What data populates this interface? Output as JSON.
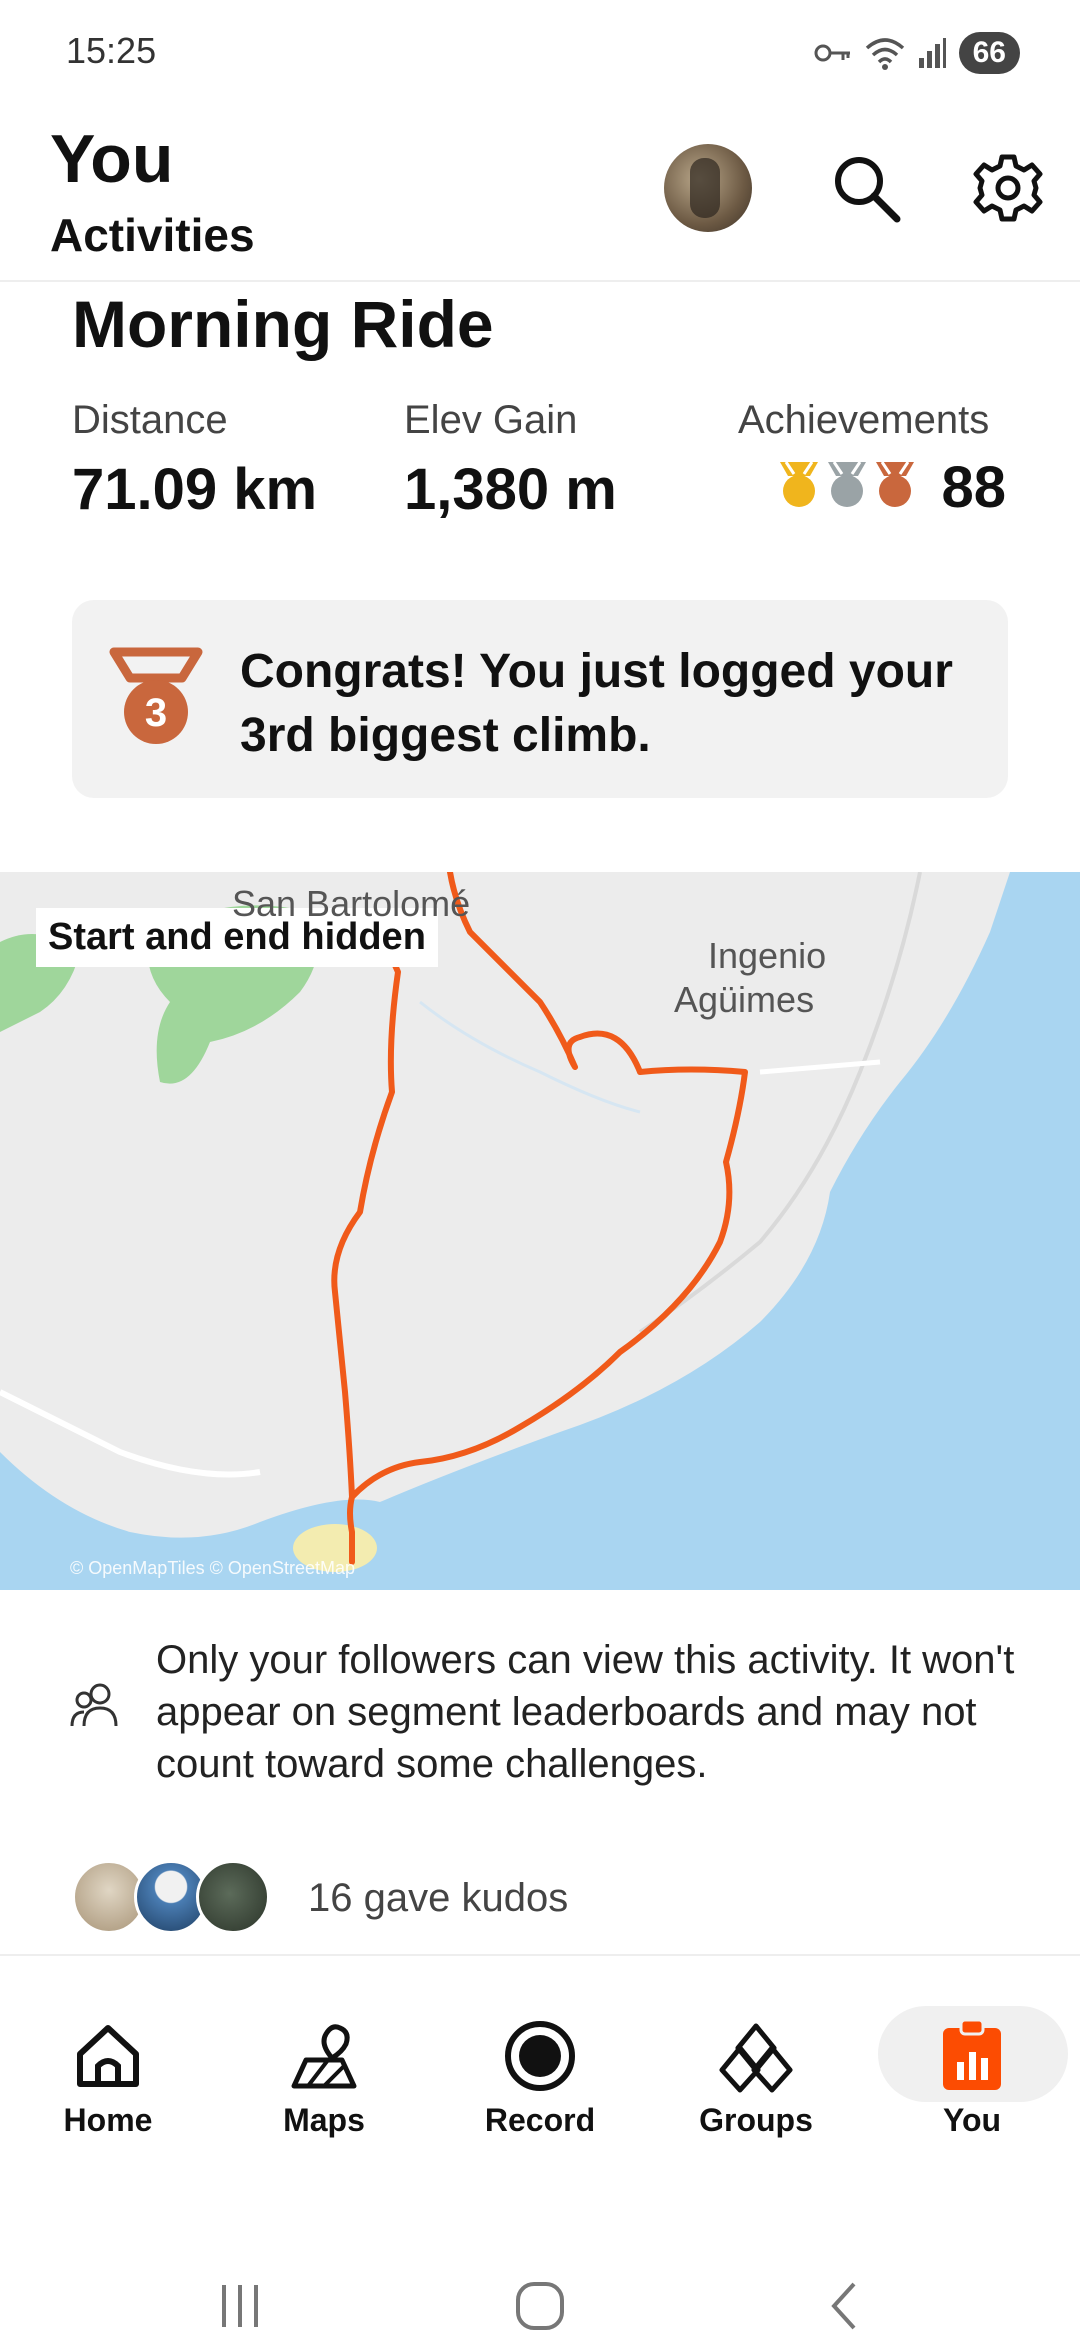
{
  "status_bar": {
    "time": "15:25",
    "battery": "66"
  },
  "header": {
    "title": "You",
    "subtitle": "Activities"
  },
  "activity": {
    "title": "Morning Ride",
    "stats": [
      {
        "label": "Distance",
        "value": "71.09 km"
      },
      {
        "label": "Elev Gain",
        "value": "1,380 m"
      },
      {
        "label": "Achievements",
        "value": "88"
      }
    ],
    "medal_colors": [
      "#f0b51d",
      "#9aa3a6",
      "#c9673d"
    ],
    "congrats": {
      "text": "Congrats! You just logged your 3rd biggest climb.",
      "medal_number": "3",
      "medal_color": "#c9673d"
    }
  },
  "map": {
    "badge": "Start and end hidden",
    "places": [
      "San Bartolomé",
      "Ingenio",
      "Agüimes"
    ],
    "attribution": "© OpenMapTiles © OpenStreetMap",
    "route_color": "#f05a1a",
    "water_color": "#a9d5f1",
    "land_color": "#ececec",
    "forest_color": "#9fd69b"
  },
  "privacy": {
    "text": "Only your followers can view this activity. It won't appear on segment leaderboards and may not count toward some challenges."
  },
  "kudos": {
    "text": "16 gave kudos"
  },
  "nav": {
    "items": [
      {
        "label": "Home",
        "icon": "home-icon"
      },
      {
        "label": "Maps",
        "icon": "maps-icon"
      },
      {
        "label": "Record",
        "icon": "record-icon"
      },
      {
        "label": "Groups",
        "icon": "groups-icon"
      },
      {
        "label": "You",
        "icon": "you-icon"
      }
    ],
    "active": "You",
    "accent": "#fc4c02"
  }
}
